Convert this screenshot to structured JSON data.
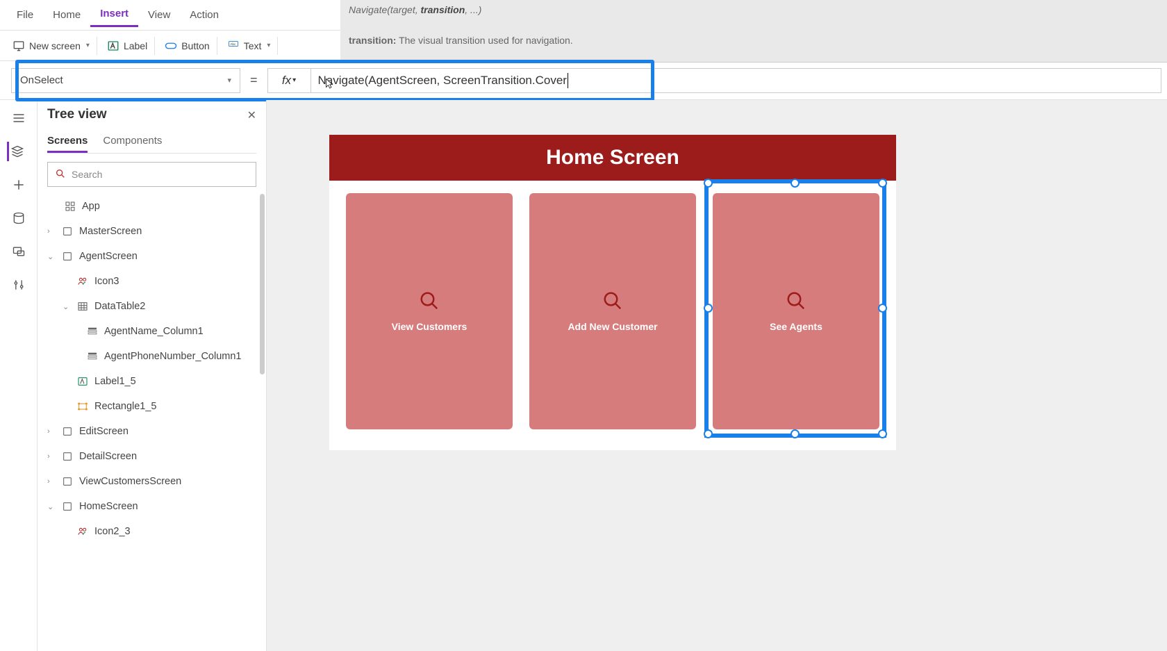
{
  "menu": {
    "file": "File",
    "home": "Home",
    "insert": "Insert",
    "view": "View",
    "action": "Action"
  },
  "hint": {
    "signature_pre": "Navigate(target, ",
    "signature_bold": "transition",
    "signature_post": ", ...)",
    "desc_label": "transition:",
    "desc_text": " The visual transition used for navigation."
  },
  "toolbar": {
    "newscreen": "New screen",
    "label": "Label",
    "button": "Button",
    "text": "Text"
  },
  "formula": {
    "property": "OnSelect",
    "equals": "=",
    "fx": "fx",
    "value": "Navigate(AgentScreen, ScreenTransition.Cover"
  },
  "treeview": {
    "title": "Tree view",
    "tab_screens": "Screens",
    "tab_components": "Components",
    "search_placeholder": "Search",
    "nodes": {
      "app": "App",
      "master": "MasterScreen",
      "agent": "AgentScreen",
      "icon3": "Icon3",
      "datatable2": "DataTable2",
      "agentname": "AgentName_Column1",
      "agentphone": "AgentPhoneNumber_Column1",
      "label15": "Label1_5",
      "rect15": "Rectangle1_5",
      "edit": "EditScreen",
      "detail": "DetailScreen",
      "viewcust": "ViewCustomersScreen",
      "homescreen": "HomeScreen",
      "icon23": "Icon2_3"
    }
  },
  "canvas": {
    "title": "Home Screen",
    "card1": "View Customers",
    "card2": "Add New Customer",
    "card3": "See Agents"
  }
}
